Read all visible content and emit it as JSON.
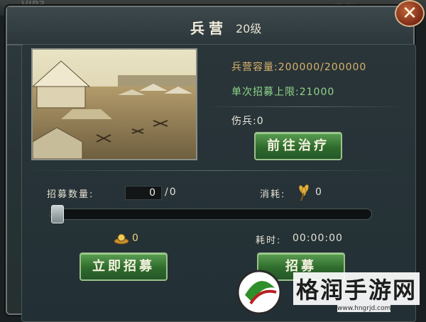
{
  "background": {
    "faded_left": "VIP3",
    "faded_right": "交 利"
  },
  "window": {
    "title": "兵营",
    "level": "20级",
    "close_icon": "close-icon"
  },
  "barracks": {
    "capacity_label": "兵营容量:",
    "capacity_value": "200000/200000",
    "recruit_limit_label": "单次招募上限:",
    "recruit_limit_value": "21000",
    "wounded_label": "伤兵:",
    "wounded_value": "0",
    "heal_button": "前往治疗"
  },
  "recruit": {
    "quantity_label": "招募数量:",
    "quantity_value": "0",
    "quantity_max": "/0",
    "consume_label": "消耗:",
    "consume_icon": "wheat-icon",
    "consume_value": "0",
    "gold_icon": "gold-ingot-icon",
    "gold_value": "0",
    "time_label": "耗时:",
    "time_value": "00:00:00",
    "instant_button": "立即招募",
    "recruit_button": "招募",
    "slider_level": 0
  },
  "watermark": {
    "brand": "格润手游网",
    "url": "www.hngrjd.com"
  },
  "colors": {
    "accent_green": "#2f6b2c",
    "gold_text": "#d8b36a",
    "recruit_limit": "#8fd68a"
  }
}
